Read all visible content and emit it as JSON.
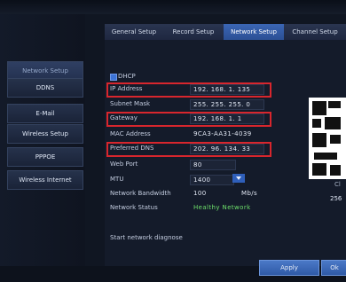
{
  "sidebar": {
    "items": [
      {
        "label": "Network Setup"
      },
      {
        "label": "DDNS"
      },
      {
        "label": "E-Mail"
      },
      {
        "label": "Wireless Setup"
      },
      {
        "label": "PPPOE"
      },
      {
        "label": "Wireless Internet"
      }
    ]
  },
  "tabs": [
    {
      "label": "General Setup"
    },
    {
      "label": "Record Setup"
    },
    {
      "label": "Network Setup"
    },
    {
      "label": "Channel Setup"
    }
  ],
  "form": {
    "dhcp_label": "DHCP",
    "rows": [
      {
        "label": "IP Address",
        "value": "192. 168.   1. 135"
      },
      {
        "label": "Subnet Mask",
        "value": "255. 255. 255.   0"
      },
      {
        "label": "Gateway",
        "value": "192. 168.   1.   1"
      },
      {
        "label": "MAC Address",
        "value": "9CA3-AA31-4039"
      },
      {
        "label": "Preferred DNS",
        "value": "202.  96. 134.  33"
      },
      {
        "label": "Web Port",
        "value": "80"
      },
      {
        "label": "MTU",
        "value": "1400"
      },
      {
        "label": "Network Bandwidth",
        "value": "100"
      },
      {
        "label": "Network Status",
        "value": "Healthy Network"
      }
    ],
    "bandwidth_unit": "Mb/s",
    "diagnose_label": "Start network diagnose"
  },
  "right_panel": {
    "text1": "Cl",
    "text2": "256"
  },
  "buttons": {
    "apply": "Apply",
    "ok": "Ok"
  },
  "colors": {
    "accent": "#2f5aa6",
    "status_ok": "#6ee06b",
    "highlight": "#d8262d"
  }
}
